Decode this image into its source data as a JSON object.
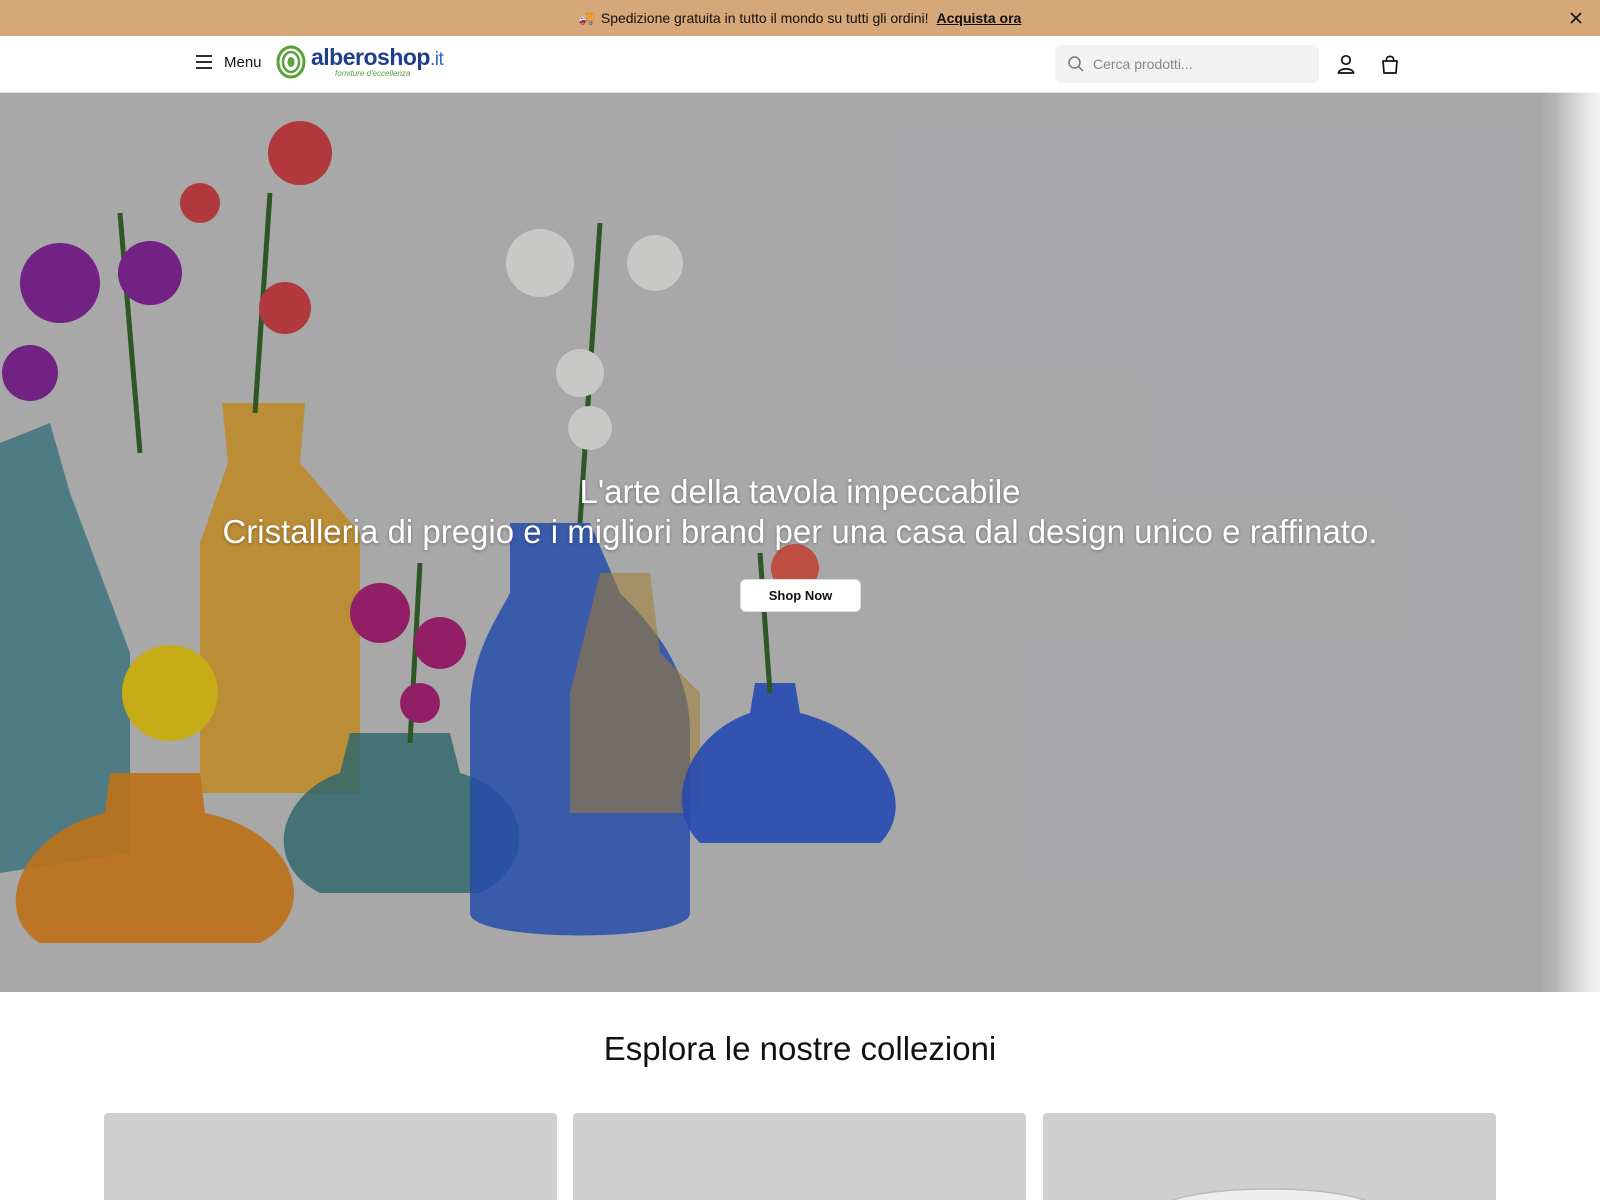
{
  "announcement": {
    "icon": "truck-icon",
    "text": "Spedizione gratuita in tutto il mondo su tutti gli ordini!",
    "link": "Acquista ora"
  },
  "header": {
    "menu_label": "Menu",
    "logo": {
      "name": "alberoshop",
      "tld": ".it",
      "tagline": "forniture d'eccellenza"
    },
    "search_placeholder": "Cerca prodotti...",
    "icons": [
      "search-icon",
      "user-icon",
      "bag-icon"
    ]
  },
  "hero": {
    "title": "L'arte della tavola impeccabile",
    "subtitle": "Cristalleria di pregio e i migliori brand per una casa dal design unico e raffinato.",
    "cta": "Shop Now"
  },
  "collections": {
    "title": "Esplora le nostre collezioni",
    "cards": 3
  },
  "colors": {
    "announcement_bg": "#d6a778",
    "logo_blue": "#1f3f8c",
    "logo_green": "#58a23a"
  }
}
